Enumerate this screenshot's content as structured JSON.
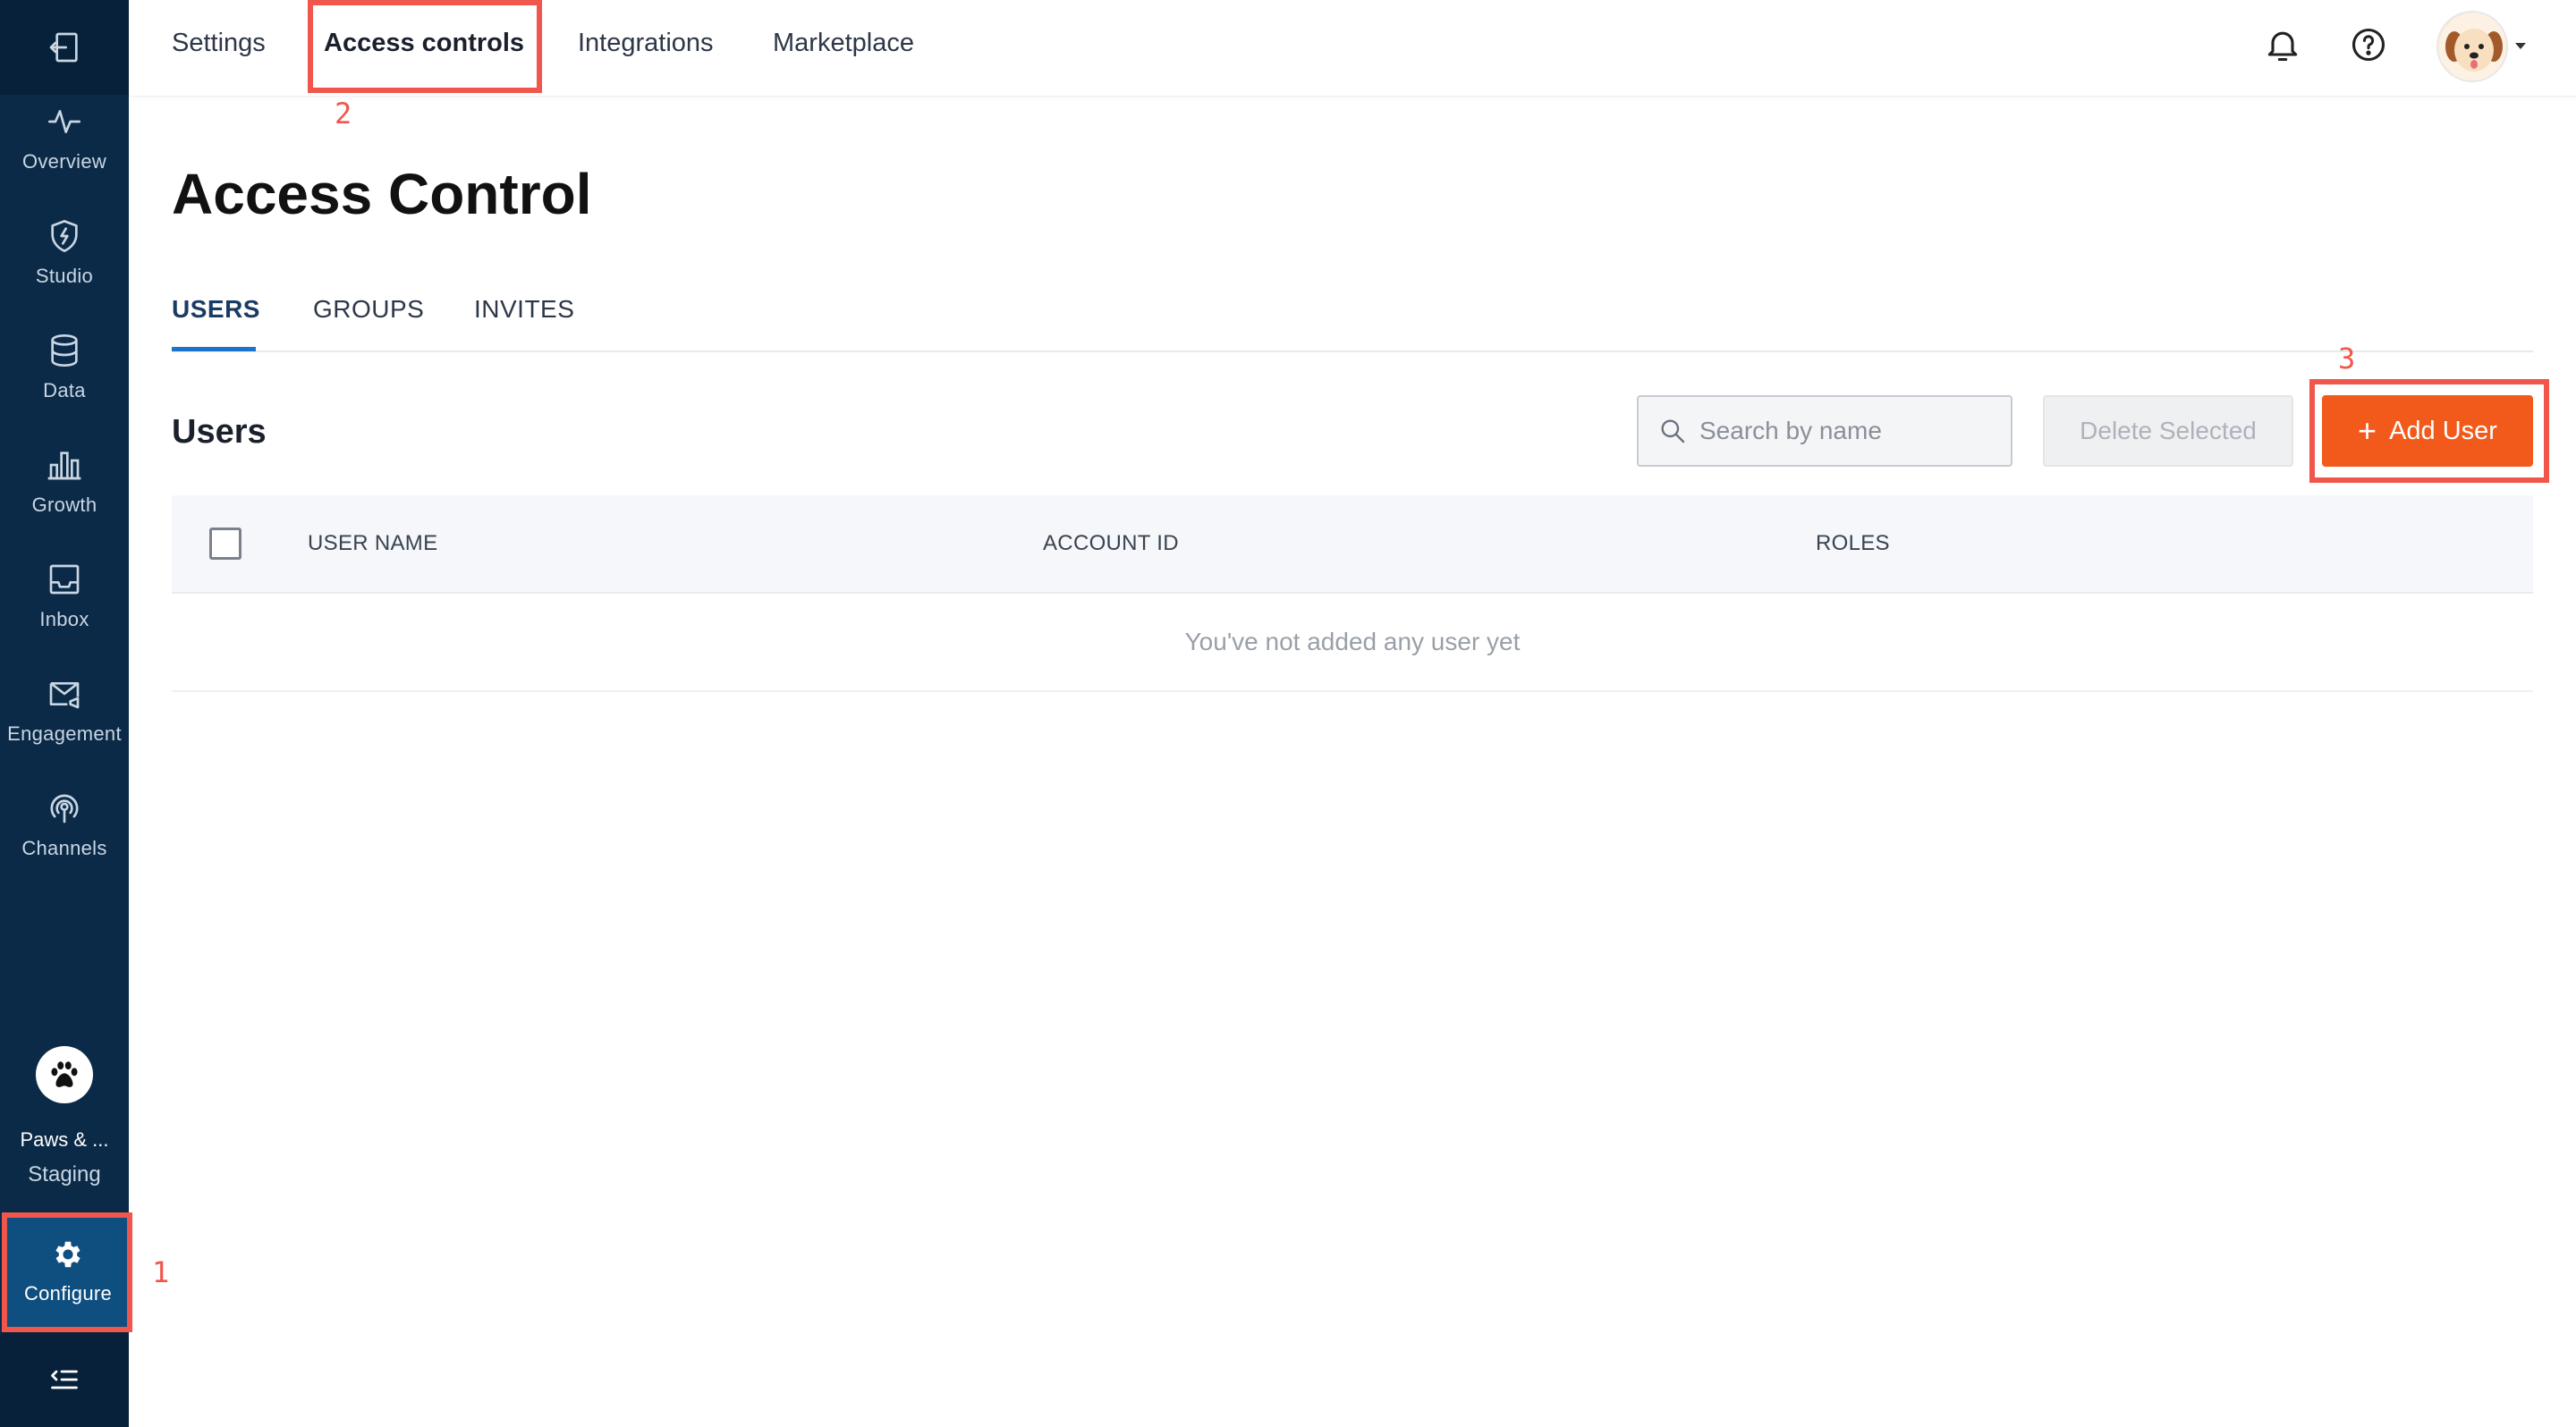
{
  "sidebar": {
    "items": [
      {
        "label": "Overview",
        "icon": "activity-icon"
      },
      {
        "label": "Studio",
        "icon": "shield-bolt-icon"
      },
      {
        "label": "Data",
        "icon": "database-icon"
      },
      {
        "label": "Growth",
        "icon": "bar-chart-icon"
      },
      {
        "label": "Inbox",
        "icon": "inbox-icon"
      },
      {
        "label": "Engagement",
        "icon": "mail-megaphone-icon"
      },
      {
        "label": "Channels",
        "icon": "broadcast-icon"
      }
    ],
    "org": {
      "name": "Paws & ...",
      "environment": "Staging",
      "icon": "paw-icon"
    },
    "configure": {
      "label": "Configure",
      "icon": "gear-icon"
    },
    "colors": {
      "background": "#0b2a47",
      "active": "#0e4f80"
    }
  },
  "topnav": {
    "items": [
      "Settings",
      "Access controls",
      "Integrations",
      "Marketplace"
    ],
    "active": "Access controls"
  },
  "page": {
    "title": "Access Control",
    "tabs": [
      "USERS",
      "GROUPS",
      "INVITES"
    ],
    "active_tab": "USERS"
  },
  "users": {
    "section_title": "Users",
    "search_placeholder": "Search by name",
    "delete_label": "Delete Selected",
    "add_label": "Add User",
    "columns": [
      "USER NAME",
      "ACCOUNT ID",
      "ROLES"
    ],
    "empty_message": "You've not added any user yet"
  },
  "annotations": [
    "1",
    "2",
    "3"
  ],
  "colors": {
    "accent": "#f15a1b",
    "highlight": "#f0564b",
    "tab_active": "#1b74c9"
  }
}
